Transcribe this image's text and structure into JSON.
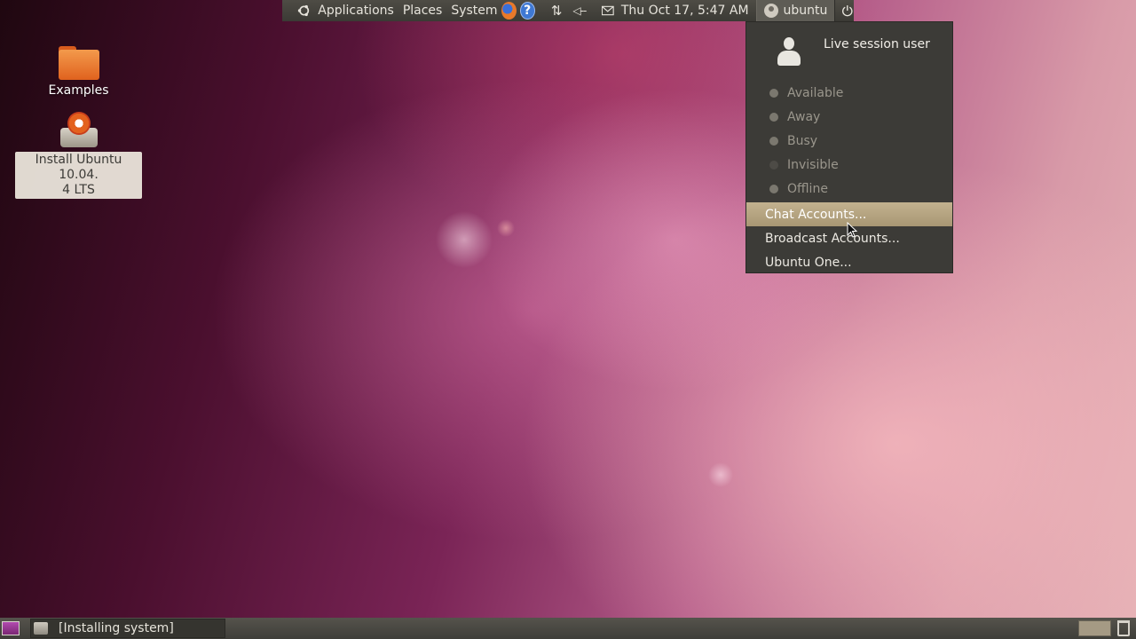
{
  "top_panel": {
    "menus": [
      "Applications",
      "Places",
      "System"
    ],
    "clock": "Thu Oct 17,  5:47 AM",
    "user_name": "ubuntu",
    "icons": {
      "distro_logo": "ubuntu-logo-icon",
      "browser": "firefox-icon",
      "help": "help-icon",
      "help_glyph": "?",
      "network": "network-icon",
      "network_glyph": "⇅",
      "volume": "volume-muted-icon",
      "volume_glyph": "◁--",
      "mail": "mail-icon",
      "user": "user-status-icon",
      "power": "power-icon"
    }
  },
  "desktop": {
    "icons": [
      {
        "label": "Examples",
        "icon": "folder-icon"
      },
      {
        "label": "Install Ubuntu 10.04.\n4 LTS",
        "icon": "installer-icon"
      }
    ]
  },
  "user_menu": {
    "session_user": "Live session user",
    "statuses": [
      "Available",
      "Away",
      "Busy",
      "Invisible",
      "Offline"
    ],
    "actions": [
      "Chat Accounts...",
      "Broadcast Accounts...",
      "Ubuntu One..."
    ],
    "highlighted_action": "Chat Accounts..."
  },
  "bottom_panel": {
    "task_label": "[Installing system]"
  },
  "colors": {
    "panel": "#3c3b37",
    "highlight": "#b7a782",
    "wallpaper_dark": "#2c0a1e",
    "wallpaper_light": "#e6b2b6"
  }
}
